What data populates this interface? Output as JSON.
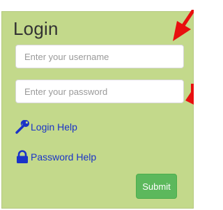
{
  "login": {
    "title": "Login",
    "username_placeholder": "Enter your username",
    "password_placeholder": "Enter your password",
    "login_help_label": "Login Help",
    "password_help_label": "Password Help",
    "submit_label": "Submit"
  },
  "icons": {
    "login_help": "wrench-icon",
    "password_help": "lock-icon",
    "annotation": "red-arrow-icon"
  },
  "colors": {
    "panel_bg": "#c3d98b",
    "link": "#1a33c8",
    "submit_bg": "#5cb85c",
    "arrow": "#e8100f"
  }
}
